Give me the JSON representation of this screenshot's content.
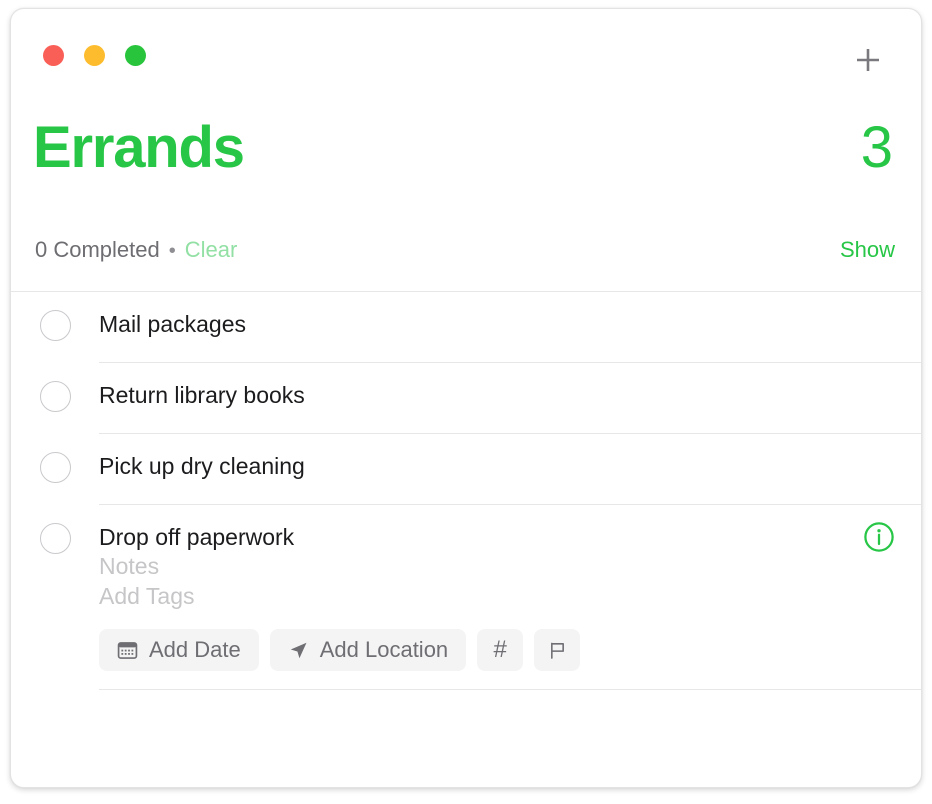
{
  "window": {
    "traffic_lights": [
      {
        "name": "close-button",
        "color": "#fa5f57"
      },
      {
        "name": "minimize-button",
        "color": "#fdbc2d"
      },
      {
        "name": "maximize-button",
        "color": "#28c53c"
      }
    ],
    "add_reminder_icon": "plus-icon"
  },
  "header": {
    "title": "Errands",
    "count": "3",
    "completed_label": "0 Completed",
    "separator": "•",
    "clear_label": "Clear",
    "show_label": "Show",
    "accent_color": "#27c646",
    "clear_color": "#92e0a4"
  },
  "tasks": [
    {
      "title": "Mail packages",
      "checked": false
    },
    {
      "title": "Return library books",
      "checked": false
    },
    {
      "title": "Pick up dry cleaning",
      "checked": false
    },
    {
      "title": "Drop off paperwork",
      "checked": false
    }
  ],
  "active_task": {
    "notes_placeholder": "Notes",
    "tags_placeholder": "Add Tags",
    "info_icon": "info-circle-icon",
    "chips": [
      {
        "label": "Add Date",
        "icon": "calendar-icon"
      },
      {
        "label": "Add Location",
        "icon": "location-arrow-icon"
      },
      {
        "label": "#",
        "icon": "hashtag-icon"
      },
      {
        "label": "",
        "icon": "flag-icon"
      }
    ]
  }
}
